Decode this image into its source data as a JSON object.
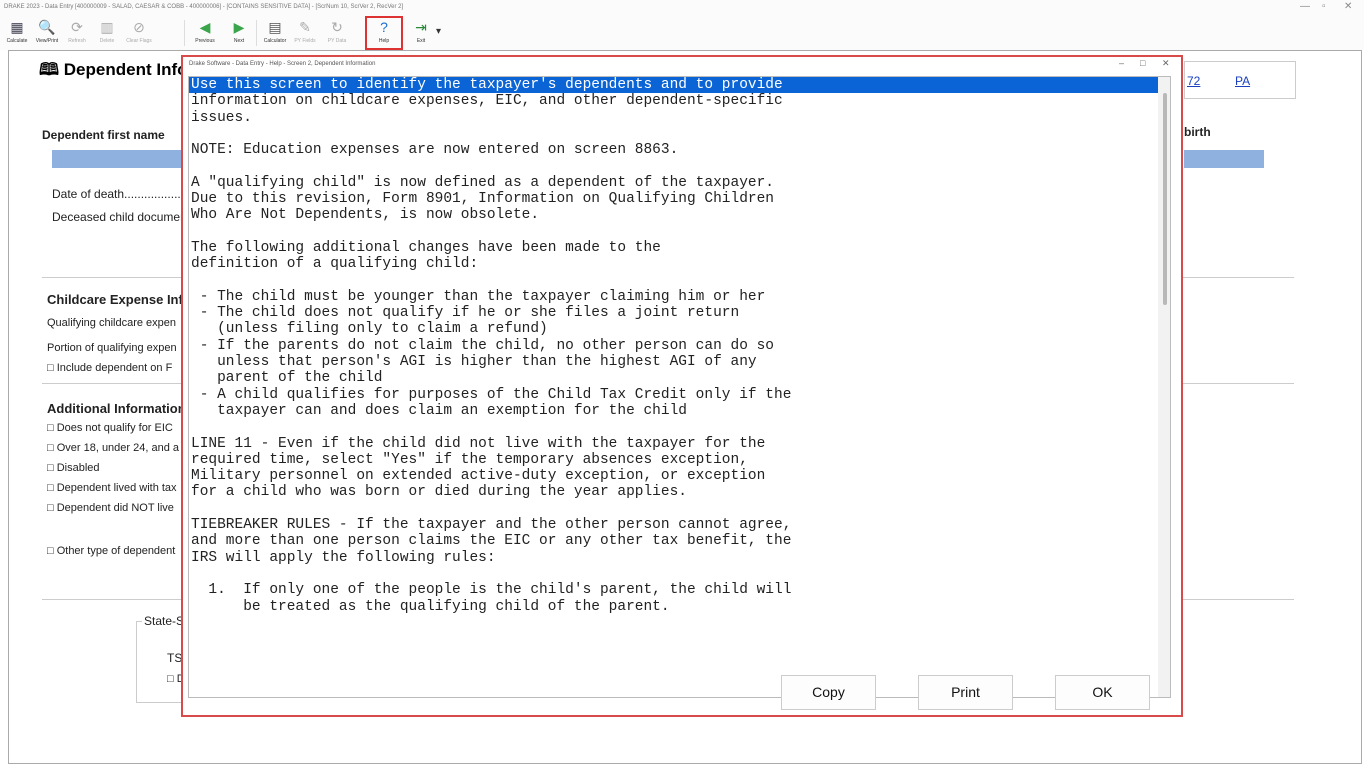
{
  "window": {
    "title": "DRAKE 2023 - Data Entry [400000009 - SALAD, CAESAR & COBB - 400000006] - [CONTAINS SENSITIVE DATA] - [ScrNum 10, ScrVer 2, RecVer 2]"
  },
  "toolbar": {
    "calculate": "Calculate",
    "view_print": "View/Print",
    "refresh": "Refresh",
    "delete": "Delete",
    "clear_flags": "Clear Flags",
    "previous": "Previous",
    "next": "Next",
    "calculator": "Calculator",
    "pyfields": "PY Fields",
    "pydata": "PY Data",
    "help": "Help",
    "exit": "Exit"
  },
  "form": {
    "title": "Dependent Info",
    "first_name": "Dependent first name",
    "birth": "birth",
    "date_of_death": "Date of death....................",
    "deceased": "Deceased child documen",
    "childcare_header": "Childcare Expense Inf",
    "qual_childcare": "Qualifying childcare expen",
    "portion": "Portion of qualifying expen",
    "include_dep": "□ Include dependent on F",
    "additional_header": "Additional Information",
    "eic": "□ Does not qualify for EIC",
    "over18": "□ Over 18, under 24, and a",
    "disabled": "□ Disabled",
    "lived_with": "□ Dependent lived with tax",
    "did_not_live": "□ Dependent did NOT live",
    "other_type": "□ Other type of dependent",
    "state_specific": "State-Sp",
    "tsj": "TSJ",
    "de": "□ De",
    "link1": "72",
    "link2": "PA"
  },
  "dialog": {
    "title": "Drake Software - Data Entry - Help - Screen 2, Dependent Information",
    "text_selected": "Use this screen to identify the taxpayer's dependents and to provide",
    "text_lines": [
      "information on childcare expenses, EIC, and other dependent-specific",
      "issues.",
      "",
      "NOTE: Education expenses are now entered on screen 8863.",
      "",
      "A \"qualifying child\" is now defined as a dependent of the taxpayer.",
      "Due to this revision, Form 8901, Information on Qualifying Children",
      "Who Are Not Dependents, is now obsolete.",
      "",
      "The following additional changes have been made to the",
      "definition of a qualifying child:",
      "",
      " - The child must be younger than the taxpayer claiming him or her",
      " - The child does not qualify if he or she files a joint return",
      "   (unless filing only to claim a refund)",
      " - If the parents do not claim the child, no other person can do so",
      "   unless that person's AGI is higher than the highest AGI of any",
      "   parent of the child",
      " - A child qualifies for purposes of the Child Tax Credit only if the",
      "   taxpayer can and does claim an exemption for the child",
      "",
      "LINE 11 - Even if the child did not live with the taxpayer for the",
      "required time, select \"Yes\" if the temporary absences exception,",
      "Military personnel on extended active-duty exception, or exception",
      "for a child who was born or died during the year applies.",
      "",
      "TIEBREAKER RULES - If the taxpayer and the other person cannot agree,",
      "and more than one person claims the EIC or any other tax benefit, the",
      "IRS will apply the following rules:",
      "",
      "  1.  If only one of the people is the child's parent, the child will",
      "      be treated as the qualifying child of the parent."
    ],
    "copy_label": "Copy",
    "print_label": "Print",
    "ok_label": "OK"
  }
}
